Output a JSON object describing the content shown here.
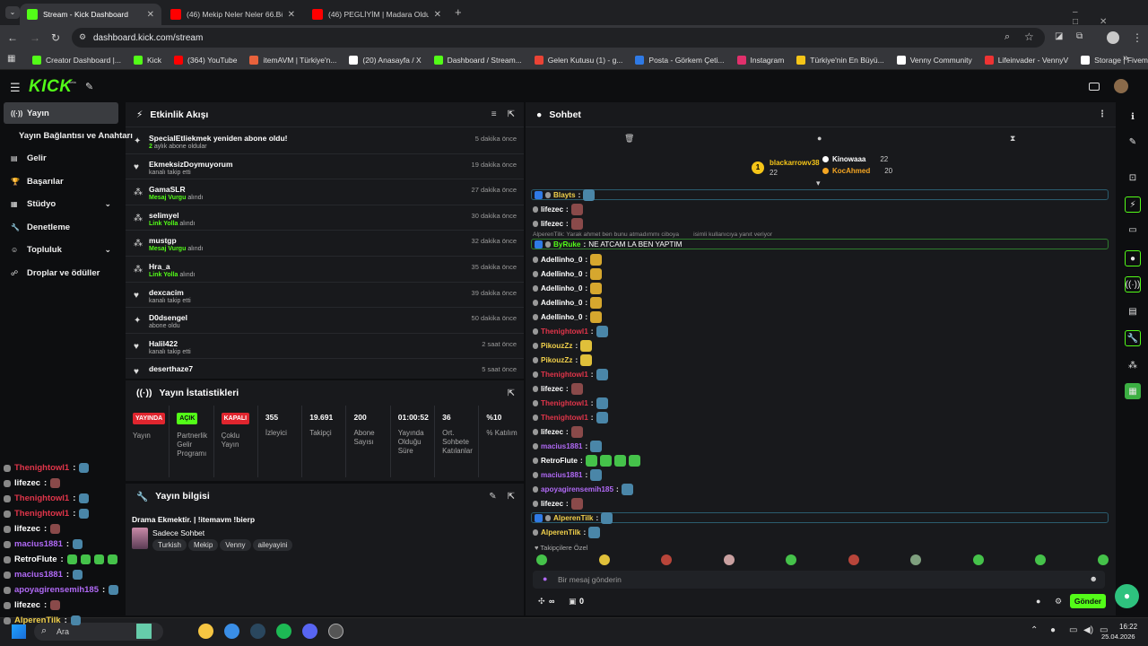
{
  "browser": {
    "tabs": [
      {
        "title": "Stream - Kick Dashboard",
        "color": "#53fc18"
      },
      {
        "title": "(46) Mekip Neler Neler 66.Bölü",
        "color": "#ff0000"
      },
      {
        "title": "(46) PEGLİYİM | Madara Olduk",
        "color": "#ff0000"
      }
    ],
    "url": "dashboard.kick.com/stream",
    "bookmarks": [
      {
        "label": "Creator Dashboard |...",
        "color": "#53fc18"
      },
      {
        "label": "Kick",
        "color": "#53fc18"
      },
      {
        "label": "(364) YouTube",
        "color": "#ff0000"
      },
      {
        "label": "itemAVM | Türkiye'n...",
        "color": "#e8623c"
      },
      {
        "label": "(20) Anasayfa / X",
        "color": "#ffffff"
      },
      {
        "label": "Dashboard / Stream...",
        "color": "#53fc18"
      },
      {
        "label": "Gelen Kutusu (1) - g...",
        "color": "#ea4335"
      },
      {
        "label": "Posta - Görkem Çeti...",
        "color": "#2f7ae5"
      },
      {
        "label": "Instagram",
        "color": "#e1306c"
      },
      {
        "label": "Türkiye'nin En Büyü...",
        "color": "#f5c518"
      },
      {
        "label": "Venny Community",
        "color": "#ffffff"
      },
      {
        "label": "Lifeinvader - VennyV",
        "color": "#e33"
      },
      {
        "label": "Storage | Fivemanage",
        "color": "#ffffff"
      }
    ]
  },
  "kick": {
    "logo": "KICK",
    "logo_sub": "beta"
  },
  "sidebar": {
    "items": [
      {
        "label": "Yayın",
        "icon": "broadcast-icon"
      },
      {
        "label": "Yayın Bağlantısı ve Anahtarı",
        "icon": ""
      },
      {
        "label": "Gelir",
        "icon": "revenue-icon"
      },
      {
        "label": "Başarılar",
        "icon": "trophy-icon"
      },
      {
        "label": "Stüdyo",
        "icon": "studio-icon"
      },
      {
        "label": "Denetleme",
        "icon": "moderation-icon"
      },
      {
        "label": "Topluluk",
        "icon": "community-icon"
      },
      {
        "label": "Droplar ve ödüller",
        "icon": "drops-icon"
      }
    ]
  },
  "mini_chat": [
    {
      "user": "Thenightowl1",
      "color": "#e0354a"
    },
    {
      "user": "lifezec",
      "color": "#ffffff"
    },
    {
      "user": "Thenightowl1",
      "color": "#e0354a"
    },
    {
      "user": "Thenightowl1",
      "color": "#e0354a"
    },
    {
      "user": "lifezec",
      "color": "#ffffff"
    },
    {
      "user": "macius1881",
      "color": "#b069f5"
    },
    {
      "user": "RetroFlute",
      "color": "#ffffff"
    },
    {
      "user": "macius1881",
      "color": "#b069f5"
    },
    {
      "user": "apoyagirensemih185",
      "color": "#b069f5"
    },
    {
      "user": "lifezec",
      "color": "#ffffff"
    },
    {
      "user": "AlperenTilk",
      "color": "#f1d04b"
    }
  ],
  "activity": {
    "title": "Etkinlik Akışı",
    "events": [
      {
        "user": "SpecialEtliekmek yeniden abone oldu!",
        "desc_hl": "2",
        "desc": " aylık abone oldular",
        "time": "5 dakika önce",
        "icon": "star-icon"
      },
      {
        "user": "EkmeksizDoymuyorum",
        "desc_hl": "",
        "desc": "kanalı takip etti",
        "time": "19 dakika önce",
        "icon": "heart-icon"
      },
      {
        "user": "GamaSLR",
        "desc_hl": "Mesaj Vurgu",
        "desc": " alındı",
        "time": "27 dakika önce",
        "icon": "reward-icon"
      },
      {
        "user": "selimyel",
        "desc_hl": "Link Yolla",
        "desc": " alındı",
        "time": "30 dakika önce",
        "icon": "reward-icon"
      },
      {
        "user": "mustgp",
        "desc_hl": "Mesaj Vurgu",
        "desc": " alındı",
        "time": "32 dakika önce",
        "icon": "reward-icon"
      },
      {
        "user": "Hra_a",
        "desc_hl": "Link Yolla",
        "desc": " alındı",
        "time": "35 dakika önce",
        "icon": "reward-icon"
      },
      {
        "user": "dexcacim",
        "desc_hl": "",
        "desc": "kanalı takip etti",
        "time": "39 dakika önce",
        "icon": "heart-icon"
      },
      {
        "user": "D0dsengel",
        "desc_hl": "",
        "desc": "abone oldu",
        "time": "50 dakika önce",
        "icon": "star-icon"
      },
      {
        "user": "Halil422",
        "desc_hl": "",
        "desc": "kanalı takip etti",
        "time": "2 saat önce",
        "icon": "heart-icon"
      },
      {
        "user": "deserthaze7",
        "desc_hl": "",
        "desc": "",
        "time": "5 saat önce",
        "icon": "heart-icon"
      }
    ]
  },
  "stats": {
    "title": "Yayın İstatistikleri",
    "cells": [
      {
        "value": "YAYINDA",
        "label": "Yayın",
        "badge": "#e0252e"
      },
      {
        "value": "AÇIK",
        "label": "Partnerlik Gelir Programı",
        "badge": "#53fc18"
      },
      {
        "value": "KAPALI",
        "label": "Çoklu Yayın",
        "badge": "#e0252e"
      },
      {
        "value": "355",
        "label": "İzleyici",
        "badge": ""
      },
      {
        "value": "19.691",
        "label": "Takipçi",
        "badge": ""
      },
      {
        "value": "200",
        "label": "Abone Sayısı",
        "badge": ""
      },
      {
        "value": "01:00:52",
        "label": "Yayında Olduğu Süre",
        "badge": ""
      },
      {
        "value": "36",
        "label": "Ort. Sohbete Katılanlar",
        "badge": ""
      },
      {
        "value": "%10",
        "label": "% Katılım",
        "badge": ""
      }
    ]
  },
  "info": {
    "title": "Yayın bilgisi",
    "stream_title": "Drama Ekmektir. | !itemavm !bierp",
    "category": "Sadece Sohbet",
    "tags": [
      "Turkish",
      "Mekip",
      "Venny",
      "aileyayini"
    ]
  },
  "chat": {
    "title": "Sohbet",
    "leaderboard": [
      {
        "rank": "1",
        "user": "blackarrowv38",
        "count": "22",
        "color": "#f5c518"
      },
      {
        "rank": "",
        "user": "Kinowaaa",
        "count": "22",
        "color": "#ffffff"
      },
      {
        "rank": "",
        "user": "KocAhmed",
        "count": "20",
        "color": "#f5a623"
      }
    ],
    "reply_note": "AlperenTilk: Yarak ahmet ben bunu atmadımmı ciboya",
    "reply_suffix": "isimli kullanıcıya yanıt veriyor",
    "messages": [
      {
        "user": "Blayts",
        "color": "#f1d04b",
        "text": "",
        "boxed": true
      },
      {
        "user": "lifezec",
        "color": "#ffffff",
        "text": ""
      },
      {
        "user": "lifezec",
        "color": "#ffffff",
        "text": ""
      },
      {
        "user": "ByRuke",
        "color": "#53fc18",
        "text": "NE ATCAM LA BEN YAPTIM",
        "boxed": true
      },
      {
        "user": "Adellinho_0",
        "color": "#ffffff",
        "text": ""
      },
      {
        "user": "Adellinho_0",
        "color": "#ffffff",
        "text": ""
      },
      {
        "user": "Adellinho_0",
        "color": "#ffffff",
        "text": ""
      },
      {
        "user": "Adellinho_0",
        "color": "#ffffff",
        "text": ""
      },
      {
        "user": "Adellinho_0",
        "color": "#ffffff",
        "text": ""
      },
      {
        "user": "Thenightowl1",
        "color": "#e0354a",
        "text": ""
      },
      {
        "user": "PikouzZz",
        "color": "#f1d04b",
        "text": ""
      },
      {
        "user": "PikouzZz",
        "color": "#f1d04b",
        "text": ""
      },
      {
        "user": "Thenightowl1",
        "color": "#e0354a",
        "text": ""
      },
      {
        "user": "lifezec",
        "color": "#ffffff",
        "text": ""
      },
      {
        "user": "Thenightowl1",
        "color": "#e0354a",
        "text": ""
      },
      {
        "user": "Thenightowl1",
        "color": "#e0354a",
        "text": ""
      },
      {
        "user": "lifezec",
        "color": "#ffffff",
        "text": ""
      },
      {
        "user": "macius1881",
        "color": "#b069f5",
        "text": ""
      },
      {
        "user": "RetroFlute",
        "color": "#ffffff",
        "text": ""
      },
      {
        "user": "macius1881",
        "color": "#b069f5",
        "text": ""
      },
      {
        "user": "apoyagirensemih185",
        "color": "#b069f5",
        "text": ""
      },
      {
        "user": "lifezec",
        "color": "#ffffff",
        "text": ""
      },
      {
        "user": "AlperenTilk",
        "color": "#f1d04b",
        "text": "",
        "boxed": true
      },
      {
        "user": "AlperenTilk",
        "color": "#f1d04b",
        "text": ""
      }
    ],
    "followers_only": "Takipçilere Özel",
    "input_placeholder": "Bir mesaj gönderin",
    "send_label": "Gönder",
    "points": "∞",
    "vault": "0"
  },
  "taskbar": {
    "search_placeholder": "Ara",
    "time": "16:22",
    "date": "25.04.2026"
  }
}
